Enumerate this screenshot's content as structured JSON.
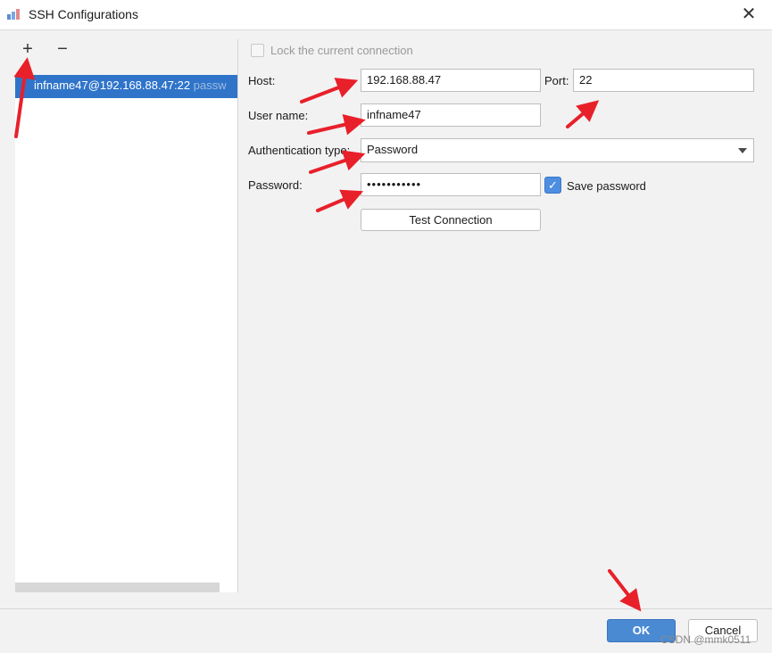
{
  "window": {
    "title": "SSH Configurations",
    "close_glyph": "✕",
    "app_icon": "ssh-app-icon"
  },
  "toolbar": {
    "add_glyph": "+",
    "remove_glyph": "−"
  },
  "config_list": {
    "items": [
      {
        "label": "infname47@192.168.88.47:22",
        "suffix": " passw"
      }
    ]
  },
  "form": {
    "lock_label": "Lock the current connection",
    "lock_checked": false,
    "host_label": "Host:",
    "host_value": "192.168.88.47",
    "port_label": "Port:",
    "port_value": "22",
    "user_label": "User name:",
    "user_value": "infname47",
    "auth_label": "Authentication type:",
    "auth_value": "Password",
    "password_label": "Password:",
    "password_value": "•••••••••••",
    "save_password_label": "Save password",
    "save_password_checked": true,
    "test_connection_label": "Test Connection"
  },
  "footer": {
    "ok_label": "OK",
    "cancel_label": "Cancel",
    "watermark": "CSDN @mmk0511"
  },
  "colors": {
    "accent": "#2f74c9",
    "ok_button": "#4a8ad3",
    "annotation_arrow": "#e8202a"
  }
}
